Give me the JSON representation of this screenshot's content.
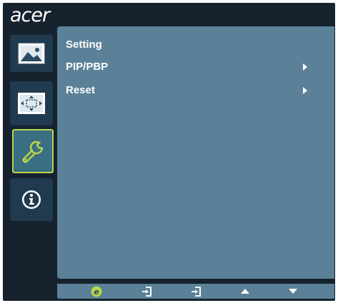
{
  "logo": {
    "text": "acer"
  },
  "sidebar": {
    "tabs": [
      {
        "icon": "picture-icon"
      },
      {
        "icon": "display-position-icon"
      },
      {
        "icon": "wrench-setting-icon",
        "selected": true
      },
      {
        "icon": "information-icon"
      }
    ]
  },
  "menu": {
    "items": [
      {
        "label": "Setting"
      },
      {
        "label": "PIP/PBP",
        "has_submenu": true
      },
      {
        "label": "Reset",
        "has_submenu": true
      }
    ]
  },
  "bottom_bar": {
    "buttons": [
      {
        "icon": "e-key-icon"
      },
      {
        "icon": "input-icon"
      },
      {
        "icon": "exit-icon"
      },
      {
        "icon": "up-arrow-icon"
      },
      {
        "icon": "down-arrow-icon"
      }
    ]
  },
  "colors": {
    "frame": "#16222e",
    "panel": "#5a8197",
    "tab": "#203a50",
    "selected_tab": "#3a6e82",
    "selected_border": "#b9d44c"
  }
}
